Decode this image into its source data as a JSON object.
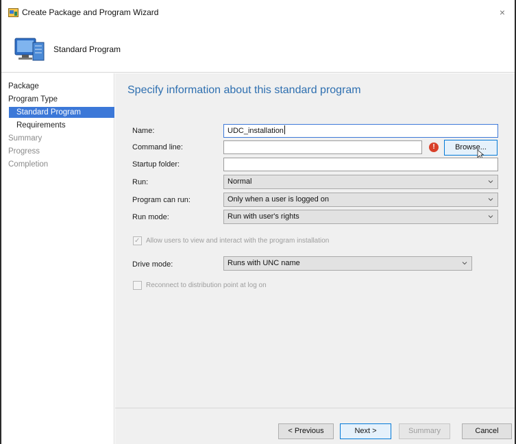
{
  "window": {
    "title": "Create Package and Program Wizard",
    "close_glyph": "×"
  },
  "header": {
    "title": "Standard Program",
    "icon": "computer-package-icon"
  },
  "sidebar": {
    "items": [
      {
        "label": "Package"
      },
      {
        "label": "Program Type"
      },
      {
        "label": "Standard Program"
      },
      {
        "label": "Requirements"
      },
      {
        "label": "Summary"
      },
      {
        "label": "Progress"
      },
      {
        "label": "Completion"
      }
    ]
  },
  "main": {
    "heading": "Specify information about this standard program",
    "name": {
      "label": "Name:",
      "value": "UDC_installation"
    },
    "command_line": {
      "label": "Command line:",
      "value": "",
      "error_glyph": "!",
      "browse_label": "Browse..."
    },
    "startup_folder": {
      "label": "Startup folder:",
      "value": ""
    },
    "run": {
      "label": "Run:",
      "selected": "Normal"
    },
    "program_can_run": {
      "label": "Program can run:",
      "selected": "Only when a user is logged on"
    },
    "run_mode": {
      "label": "Run mode:",
      "selected": "Run with user's rights"
    },
    "allow_users": {
      "label": "Allow users to view and interact with the program installation",
      "checked": true,
      "enabled": false
    },
    "drive_mode": {
      "label": "Drive mode:",
      "selected": "Runs with UNC name"
    },
    "reconnect": {
      "label": "Reconnect to distribution point at log on",
      "checked": false,
      "enabled": false
    }
  },
  "footer": {
    "previous_label": "< Previous",
    "next_label": "Next >",
    "summary_label": "Summary",
    "cancel_label": "Cancel"
  },
  "colors": {
    "accent": "#3c78d8",
    "heading": "#2e6fb0",
    "error": "#d8402a"
  }
}
